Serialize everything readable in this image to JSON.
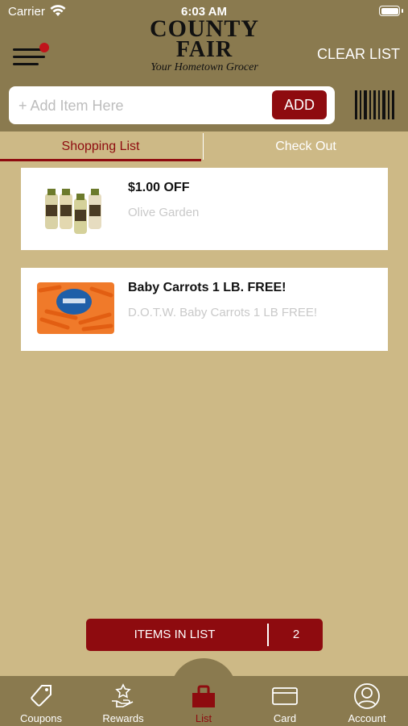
{
  "status_bar": {
    "carrier": "Carrier",
    "time": "6:03 AM",
    "wifi_icon": "wifi-icon",
    "battery_icon": "battery-icon"
  },
  "header": {
    "logo_line1": "COUNTY",
    "logo_line2": "FAIR",
    "logo_tagline": "Your Hometown Grocer",
    "clear_list_label": "CLEAR LIST",
    "menu_icon": "hamburger-menu-icon",
    "notification_color": "#c0141b"
  },
  "search": {
    "placeholder": "+ Add Item Here",
    "value": "",
    "add_label": "ADD",
    "barcode_icon": "barcode-scanner-icon"
  },
  "tabs": [
    {
      "label": "Shopping List",
      "active": true
    },
    {
      "label": "Check Out",
      "active": false
    }
  ],
  "list_items": [
    {
      "title": "$1.00 OFF",
      "description": "Olive Garden",
      "image": "olive-garden-dressing-bottles"
    },
    {
      "title": "Baby Carrots 1 LB. FREE!",
      "description": "D.O.T.W. Baby Carrots 1 LB FREE!",
      "image": "baby-carrots-bag"
    }
  ],
  "items_bar": {
    "label": "ITEMS IN LIST",
    "count": "2"
  },
  "tab_bar": [
    {
      "label": "Coupons",
      "icon": "tag-icon",
      "active": false
    },
    {
      "label": "Rewards",
      "icon": "hand-star-icon",
      "active": false
    },
    {
      "label": "List",
      "icon": "basket-icon",
      "active": true
    },
    {
      "label": "Card",
      "icon": "card-icon",
      "active": false
    },
    {
      "label": "Account",
      "icon": "user-circle-icon",
      "active": false
    }
  ],
  "colors": {
    "header_bg": "#8a7a4f",
    "page_bg": "#cdb986",
    "accent": "#8e0b0f"
  }
}
